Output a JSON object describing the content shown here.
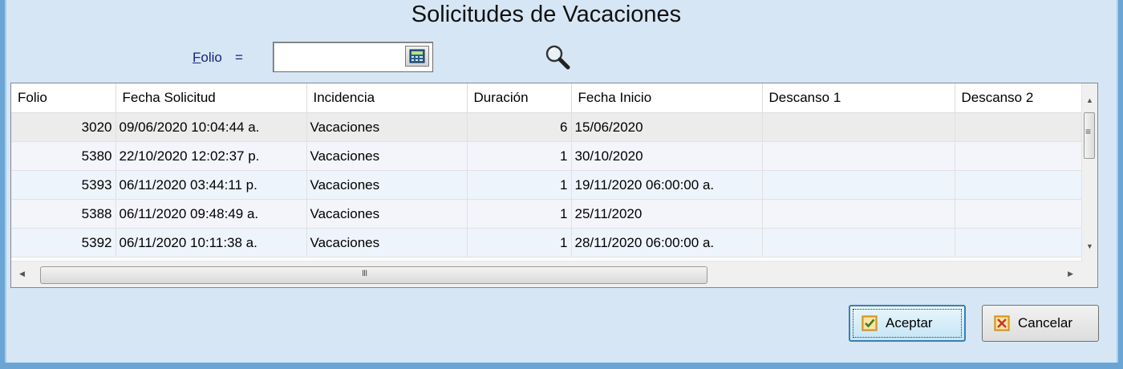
{
  "window": {
    "title": "Solicitudes de Vacaciones"
  },
  "filter": {
    "label_accel": "F",
    "label_rest": "olio",
    "operator": "=",
    "value": ""
  },
  "table": {
    "columns": [
      "Folio",
      "Fecha Solicitud",
      "Incidencia",
      "Duración",
      "Fecha Inicio",
      "Descanso 1",
      "Descanso 2"
    ],
    "rows": [
      [
        "3020",
        "09/06/2020 10:04:44 a.",
        "Vacaciones",
        "6",
        "15/06/2020",
        "",
        ""
      ],
      [
        "5380",
        "22/10/2020 12:02:37 p.",
        "Vacaciones",
        "1",
        "30/10/2020",
        "",
        ""
      ],
      [
        "5393",
        "06/11/2020 03:44:11 p.",
        "Vacaciones",
        "1",
        "19/11/2020 06:00:00 a.",
        "",
        ""
      ],
      [
        "5388",
        "06/11/2020 09:48:49 a.",
        "Vacaciones",
        "1",
        "25/11/2020",
        "",
        ""
      ],
      [
        "5392",
        "06/11/2020 10:11:38 a.",
        "Vacaciones",
        "1",
        "28/11/2020 06:00:00 a.",
        "",
        ""
      ]
    ]
  },
  "buttons": {
    "ok_label": "Aceptar",
    "cancel_label": "Cancelar"
  },
  "icons": {
    "calculator": "calculator-icon",
    "search": "magnifier-icon",
    "ok": "checkbox-check-icon",
    "cancel": "checkbox-x-icon"
  },
  "colors": {
    "background": "#d6e6f5",
    "frame": "#6aa5d6",
    "label": "#1a237e",
    "ok_border": "#3c7fb1",
    "icon_orange": "#f0a020"
  }
}
